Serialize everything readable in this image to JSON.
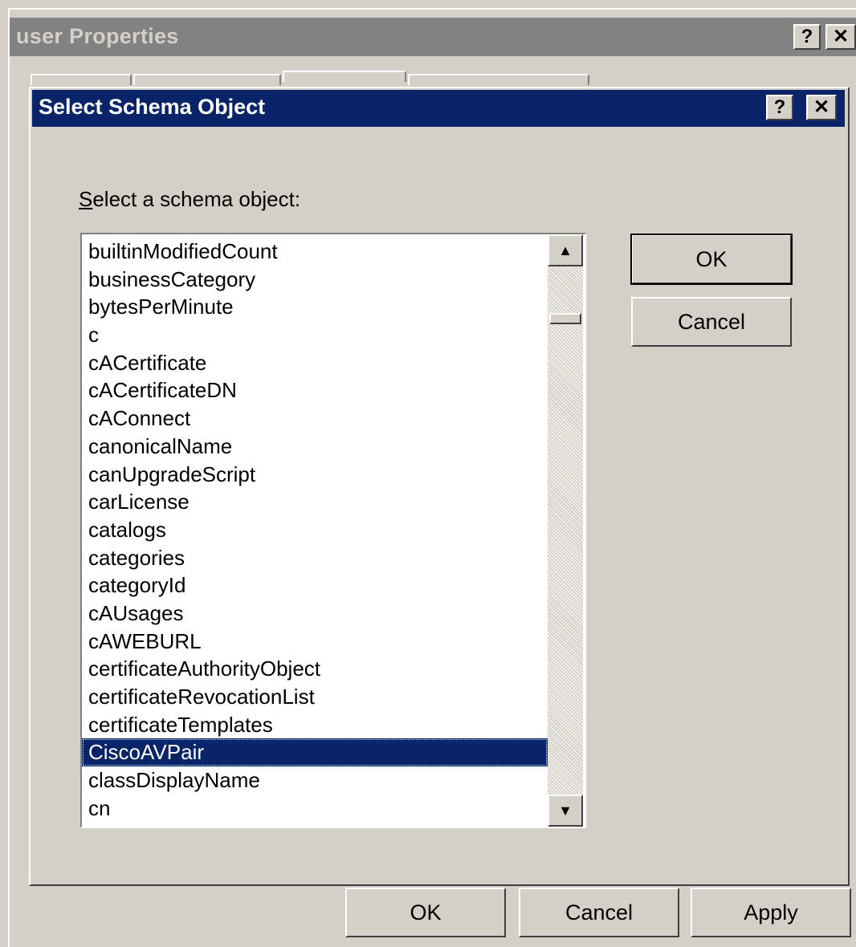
{
  "outer_window": {
    "title": "user Properties",
    "help_label": "?",
    "close_label": "✕",
    "buttons": {
      "ok_label": "OK",
      "cancel_label": "Cancel",
      "apply_label": "Apply"
    }
  },
  "dialog": {
    "title": "Select Schema Object",
    "help_label": "?",
    "close_label": "✕",
    "prompt": "Select a schema object:",
    "items": [
      "builtinModifiedCount",
      "businessCategory",
      "bytesPerMinute",
      "c",
      "cACertificate",
      "cACertificateDN",
      "cAConnect",
      "canonicalName",
      "canUpgradeScript",
      "carLicense",
      "catalogs",
      "categories",
      "categoryId",
      "cAUsages",
      "cAWEBURL",
      "certificateAuthorityObject",
      "certificateRevocationList",
      "certificateTemplates",
      "CiscoAVPair",
      "classDisplayName",
      "cn"
    ],
    "selected_item": "CiscoAVPair",
    "scroll_up_icon": "▲",
    "scroll_down_icon": "▼",
    "ok_label": "OK",
    "cancel_label": "Cancel"
  },
  "colors": {
    "face": "#d4d0c8",
    "active_title": "#0a246a",
    "inactive_title": "#828282",
    "selection": "#0a246a"
  }
}
